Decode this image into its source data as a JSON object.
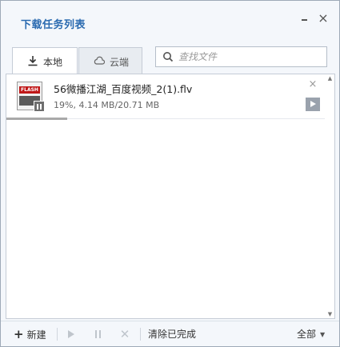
{
  "window": {
    "title": "下载任务列表",
    "minimize_icon": "minimize-icon",
    "close_icon": "close-icon"
  },
  "tabs": [
    {
      "label": "本地",
      "icon": "download-icon",
      "active": true
    },
    {
      "label": "云端",
      "icon": "cloud-icon",
      "active": false
    }
  ],
  "search": {
    "placeholder": "查找文件",
    "value": ""
  },
  "downloads": [
    {
      "filename": "56微播江湖_百度视频_2(1).flv",
      "status": "19%, 4.14 MB/20.71 MB",
      "progress": 0.19,
      "type_badge": "FLASH"
    }
  ],
  "footer": {
    "new_label": "新建",
    "clear_label": "清除已完成",
    "filter_label": "全部"
  },
  "colors": {
    "accent": "#2a6ab0",
    "flash_badge": "#c01818"
  }
}
